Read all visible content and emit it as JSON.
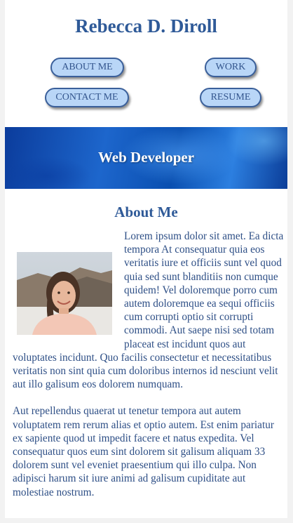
{
  "site": {
    "title": "Rebecca D. Diroll"
  },
  "nav": {
    "about": "ABOUT ME",
    "work": "WORK",
    "contact": "CONTACT ME",
    "resume": "RESUME"
  },
  "banner": {
    "heading": "Web Developer"
  },
  "about": {
    "heading": "About Me",
    "portrait_icon": "person-photo",
    "paragraph1": "Lorem ipsum dolor sit amet. Ea dicta tempora At consequatur quia eos veritatis iure et officiis sunt vel quod quia sed sunt blanditiis non cumque quidem! Vel doloremque porro cum autem doloremque ea sequi officiis cum corrupti optio sit corrupti commodi. Aut saepe nisi sed totam placeat est incidunt quos aut voluptates incidunt. Quo facilis consectetur et necessitatibus veritatis non sint quia cum doloribus internos id nesciunt velit aut illo galisum eos dolorem numquam.",
    "paragraph2": "Aut repellendus quaerat ut tenetur tempora aut autem voluptatem rem rerum alias et optio autem. Est enim pariatur ex sapiente quod ut impedit facere et natus expedita. Vel consequatur quos eum sint dolorem sit galisum aliquam 33 dolorem sunt vel eveniet praesentium qui illo culpa. Non adipisci harum sit iure animi ad galisum cupiditate aut molestiae nostrum."
  },
  "colors": {
    "accent": "#2f5a98",
    "button_fill": "#b9d6f7",
    "banner_blue": "#1d66cc"
  }
}
